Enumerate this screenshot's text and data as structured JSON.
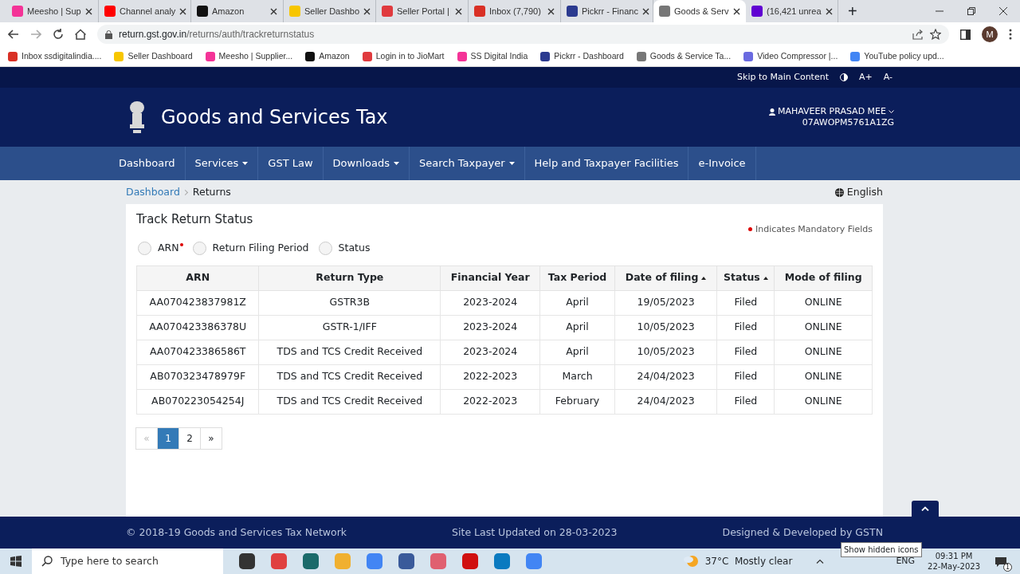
{
  "browser": {
    "tabs": [
      {
        "label": "Meesho | Sup",
        "selected": false
      },
      {
        "label": "Channel analy",
        "selected": false
      },
      {
        "label": "Amazon",
        "selected": false
      },
      {
        "label": "Seller Dashbo",
        "selected": false
      },
      {
        "label": "Seller Portal |",
        "selected": false
      },
      {
        "label": "Inbox (7,790)",
        "selected": false
      },
      {
        "label": "Pickrr - Financ",
        "selected": false
      },
      {
        "label": "Goods & Serv",
        "selected": true
      },
      {
        "label": "(16,421 unrea",
        "selected": false
      }
    ],
    "new_tab": "+",
    "avatar": "M",
    "url_host": "return.gst.gov.in",
    "url_path": "/returns/auth/trackreturnstatus",
    "bookmarks": [
      "Inbox ssdigitalindia....",
      "Seller Dashboard",
      "Meesho | Supplier...",
      "Amazon",
      "Login in to JioMart",
      "SS Digital India",
      "Pickrr - Dashboard",
      "Goods & Service Ta...",
      "Video Compressor |...",
      "YouTube policy upd..."
    ]
  },
  "site": {
    "skip_link": "Skip to Main Content",
    "font_up": "A+",
    "font_down": "A-",
    "title": "Goods and Services Tax",
    "user_name": "MAHAVEER PRASAD MEE",
    "user_gstin": "07AWOPM5761A1ZG",
    "nav": [
      {
        "label": "Dashboard",
        "dropdown": false
      },
      {
        "label": "Services",
        "dropdown": true
      },
      {
        "label": "GST Law",
        "dropdown": false
      },
      {
        "label": "Downloads",
        "dropdown": true
      },
      {
        "label": "Search Taxpayer",
        "dropdown": true
      },
      {
        "label": "Help and Taxpayer Facilities",
        "dropdown": false
      },
      {
        "label": "e-Invoice",
        "dropdown": false
      }
    ],
    "breadcrumb": [
      "Dashboard",
      "Returns"
    ],
    "language": "English",
    "heading": "Track Return Status",
    "mandatory_note": "Indicates Mandatory Fields",
    "search_by": [
      {
        "label": "ARN",
        "required": true,
        "selected": false
      },
      {
        "label": "Return Filing Period",
        "required": false,
        "selected": false
      },
      {
        "label": "Status",
        "required": false,
        "selected": false
      }
    ],
    "table": {
      "columns": [
        {
          "label": "ARN",
          "sortable": false
        },
        {
          "label": "Return Type",
          "sortable": false
        },
        {
          "label": "Financial Year",
          "sortable": false
        },
        {
          "label": "Tax Period",
          "sortable": false
        },
        {
          "label": "Date of filing",
          "sortable": true
        },
        {
          "label": "Status",
          "sortable": true
        },
        {
          "label": "Mode of filing",
          "sortable": false
        }
      ],
      "rows": [
        [
          "AA070423837981Z",
          "GSTR3B",
          "2023-2024",
          "April",
          "19/05/2023",
          "Filed",
          "ONLINE"
        ],
        [
          "AA070423386378U",
          "GSTR-1/IFF",
          "2023-2024",
          "April",
          "10/05/2023",
          "Filed",
          "ONLINE"
        ],
        [
          "AA070423386586T",
          "TDS and TCS Credit Received",
          "2023-2024",
          "April",
          "10/05/2023",
          "Filed",
          "ONLINE"
        ],
        [
          "AB070323478979F",
          "TDS and TCS Credit Received",
          "2022-2023",
          "March",
          "24/04/2023",
          "Filed",
          "ONLINE"
        ],
        [
          "AB070223054254J",
          "TDS and TCS Credit Received",
          "2022-2023",
          "February",
          "24/04/2023",
          "Filed",
          "ONLINE"
        ]
      ]
    },
    "pagination": {
      "prev": "«",
      "next": "»",
      "pages": [
        {
          "label": "1",
          "selected": true
        },
        {
          "label": "2",
          "selected": false
        }
      ]
    },
    "footer": {
      "copyright": "© 2018-19 Goods and Services Tax Network",
      "updated": "Site Last Updated on 28-03-2023",
      "credit": "Designed & Developed by GSTN"
    }
  },
  "taskbar": {
    "search_placeholder": "Type here to search",
    "weather": "37°C  Mostly clear",
    "tooltip": "Show hidden icons",
    "language": "ENG",
    "time": "09:31 PM",
    "date": "22-May-2023",
    "notifications": "1"
  }
}
